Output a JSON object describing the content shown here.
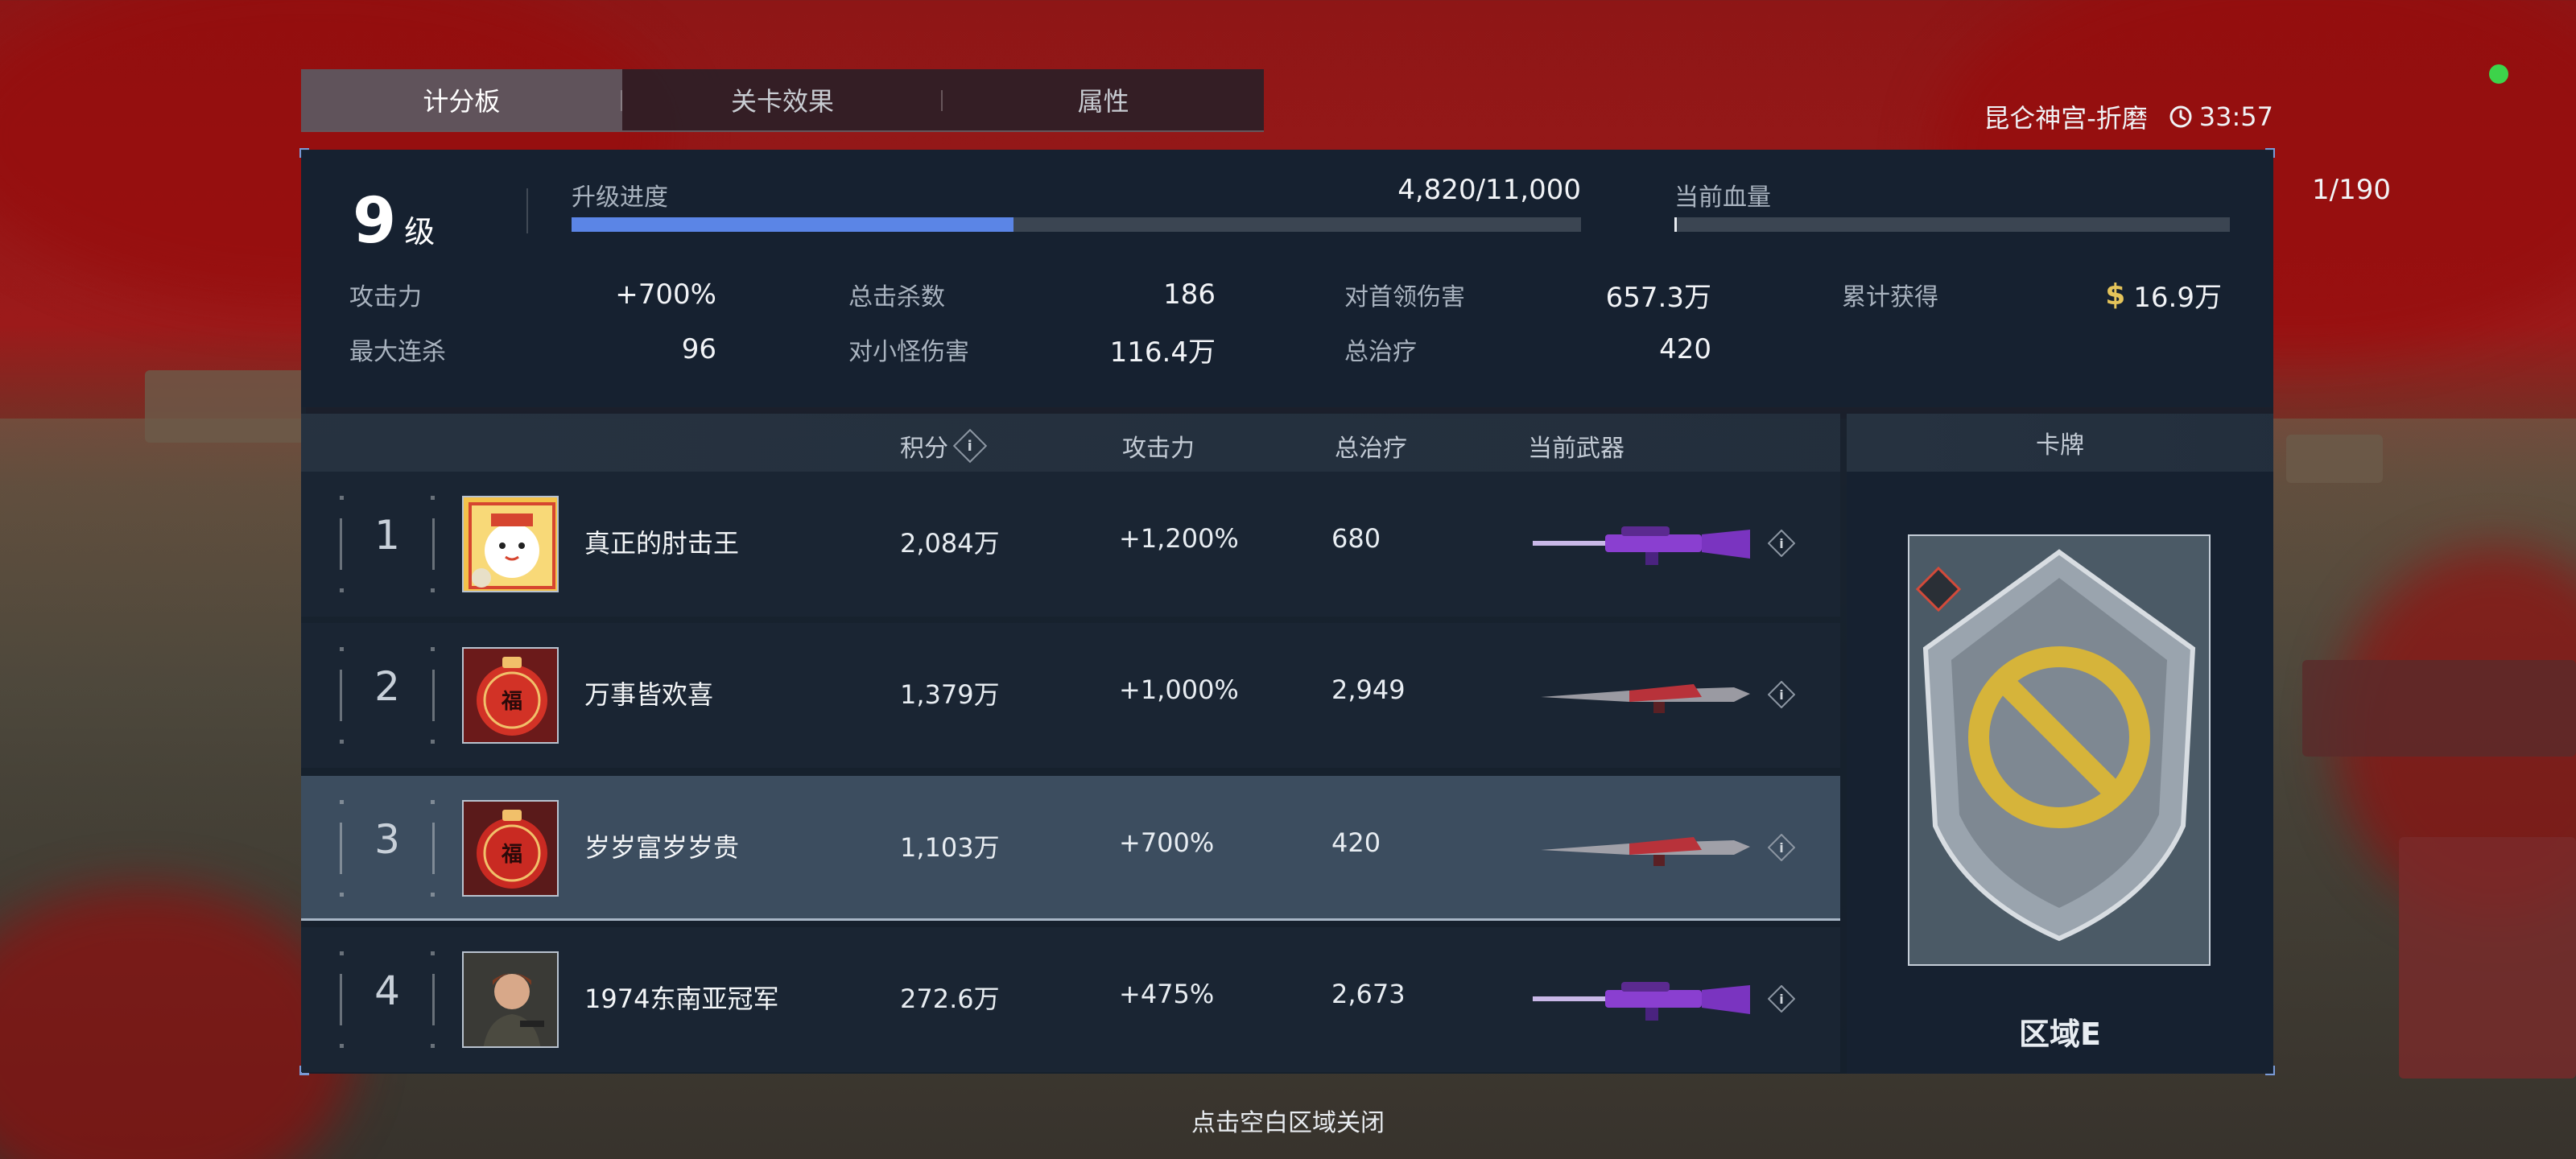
{
  "tabs": [
    {
      "label": "计分板",
      "active": true
    },
    {
      "label": "关卡效果",
      "active": false
    },
    {
      "label": "属性",
      "active": false
    }
  ],
  "map": {
    "name": "昆仑神宫-折磨",
    "time": "33:57"
  },
  "player": {
    "level": "9",
    "level_unit": "级",
    "progress_label": "升级进度",
    "progress_value": "4,820/11,000",
    "progress_fraction": 0.438,
    "hp_label": "当前血量",
    "hp_value": "1/190",
    "hp_fraction": 0.005
  },
  "stats": [
    {
      "label": "攻击力",
      "value": "+700%"
    },
    {
      "label": "总击杀数",
      "value": "186"
    },
    {
      "label": "对首领伤害",
      "value": "657.3万"
    },
    {
      "label": "累计获得",
      "value": "16.9万"
    },
    {
      "label": "最大连杀",
      "value": "96"
    },
    {
      "label": "对小怪伤害",
      "value": "116.4万"
    },
    {
      "label": "总治疗",
      "value": "420"
    }
  ],
  "currency_symbol": "$",
  "table": {
    "headers": {
      "score": "积分",
      "attack": "攻击力",
      "heal": "总治疗",
      "weapon": "当前武器"
    },
    "info_glyph": "i",
    "rows": [
      {
        "rank": "1",
        "name": "真正的肘击王",
        "score": "2,084万",
        "attack": "+1,200%",
        "heal": "680",
        "weapon": "purple",
        "avatar": "cat"
      },
      {
        "rank": "2",
        "name": "万事皆欢喜",
        "score": "1,379万",
        "attack": "+1,000%",
        "heal": "2,949",
        "weapon": "red",
        "avatar": "red-charm"
      },
      {
        "rank": "3",
        "name": "岁岁富岁岁贵",
        "score": "1,103万",
        "attack": "+700%",
        "heal": "420",
        "weapon": "red",
        "avatar": "red-charm"
      },
      {
        "rank": "4",
        "name": "1974东南亚冠军",
        "score": "272.6万",
        "attack": "+475%",
        "heal": "2,673",
        "weapon": "purple",
        "avatar": "soldier"
      }
    ]
  },
  "card": {
    "header": "卡牌",
    "title": "区域E"
  },
  "close_hint": "点击空白区域关闭",
  "colors": {
    "accent_blue": "#5b85e6",
    "coin_gold": "#e5c45a",
    "status_green": "#3dd34a",
    "highlight_row": "#3e5062"
  }
}
